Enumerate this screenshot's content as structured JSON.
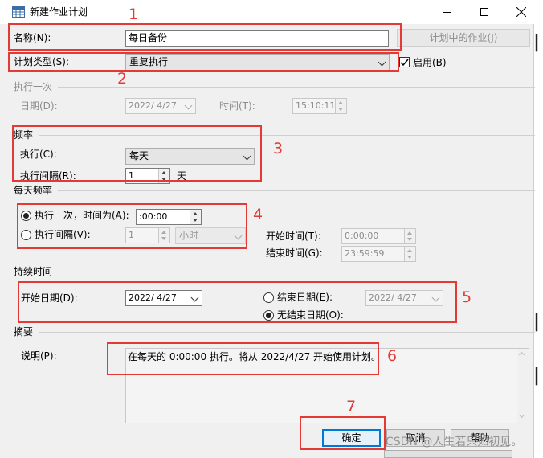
{
  "window": {
    "title": "新建作业计划"
  },
  "general": {
    "name_label": "名称(N):",
    "name_value": "每日备份",
    "jobs_in_schedule_button": "计划中的作业(J)",
    "type_label": "计划类型(S):",
    "type_value": "重复执行",
    "enabled_label": "启用(B)",
    "enabled": true
  },
  "one_time": {
    "section": "执行一次",
    "date_label": "日期(D):",
    "date_value": "2022/ 4/27",
    "time_label": "时间(T):",
    "time_value": "15:10:11"
  },
  "frequency": {
    "section": "频率",
    "occurs_label": "执行(C):",
    "occurs_value": "每天",
    "interval_label": "执行间隔(R):",
    "interval_value": "1",
    "interval_unit": "天"
  },
  "daily_frequency": {
    "section": "每天频率",
    "once_label": "执行一次，时间为(A):",
    "once_time": ":00:00",
    "every_label": "执行间隔(V):",
    "every_value": "1",
    "every_unit": "小时",
    "start_label": "开始时间(T):",
    "start_value": "0:00:00",
    "end_label": "结束时间(G):",
    "end_value": "23:59:59"
  },
  "duration": {
    "section": "持续时间",
    "start_date_label": "开始日期(D):",
    "start_date_value": "2022/ 4/27",
    "end_date_label": "结束日期(E):",
    "end_date_value": "2022/ 4/27",
    "no_end_label": "无结束日期(O):"
  },
  "summary": {
    "section": "摘要",
    "desc_label": "说明(P):",
    "desc_text": "在每天的 0:00:00 执行。将从 2022/4/27 开始使用计划。"
  },
  "buttons": {
    "ok": "确定",
    "cancel": "取消",
    "help": "帮助"
  },
  "annotations": [
    "1",
    "2",
    "3",
    "4",
    "5",
    "6",
    "7"
  ],
  "watermark": "CSDN @人生若只如初见。",
  "colors": {
    "annotation": "#e53935",
    "focus": "#0078d7"
  }
}
